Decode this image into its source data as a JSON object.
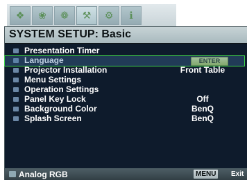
{
  "tabs": [
    {
      "icon": "display-icon",
      "glyph": "❖",
      "active": false
    },
    {
      "icon": "picture-icon",
      "glyph": "❀",
      "active": false
    },
    {
      "icon": "source-icon",
      "glyph": "❁",
      "active": false
    },
    {
      "icon": "system-setup-icon",
      "glyph": "⚒",
      "active": true
    },
    {
      "icon": "advanced-setup-icon",
      "glyph": "⚙",
      "active": false
    },
    {
      "icon": "information-icon",
      "glyph": "ℹ",
      "active": false
    }
  ],
  "header": {
    "title": "SYSTEM SETUP: Basic"
  },
  "menu": {
    "items": [
      {
        "label": "Presentation Timer",
        "value": "",
        "selected": false
      },
      {
        "label": "Language",
        "value": "ENTER",
        "selected": true
      },
      {
        "label": "Projector Installation",
        "value": "Front Table",
        "selected": false
      },
      {
        "label": "Menu Settings",
        "value": "",
        "selected": false
      },
      {
        "label": "Operation Settings",
        "value": "",
        "selected": false
      },
      {
        "label": "Panel Key Lock",
        "value": "Off",
        "selected": false
      },
      {
        "label": "Background Color",
        "value": "BenQ",
        "selected": false
      },
      {
        "label": "Splash Screen",
        "value": "BenQ",
        "selected": false
      }
    ]
  },
  "footer": {
    "source": "Analog RGB",
    "menu_key": "MENU",
    "exit_label": "Exit"
  },
  "colors": {
    "panel_background": "#0e1b2c",
    "highlight_border": "#3fd14a",
    "enter_button": "#b7d15e"
  }
}
